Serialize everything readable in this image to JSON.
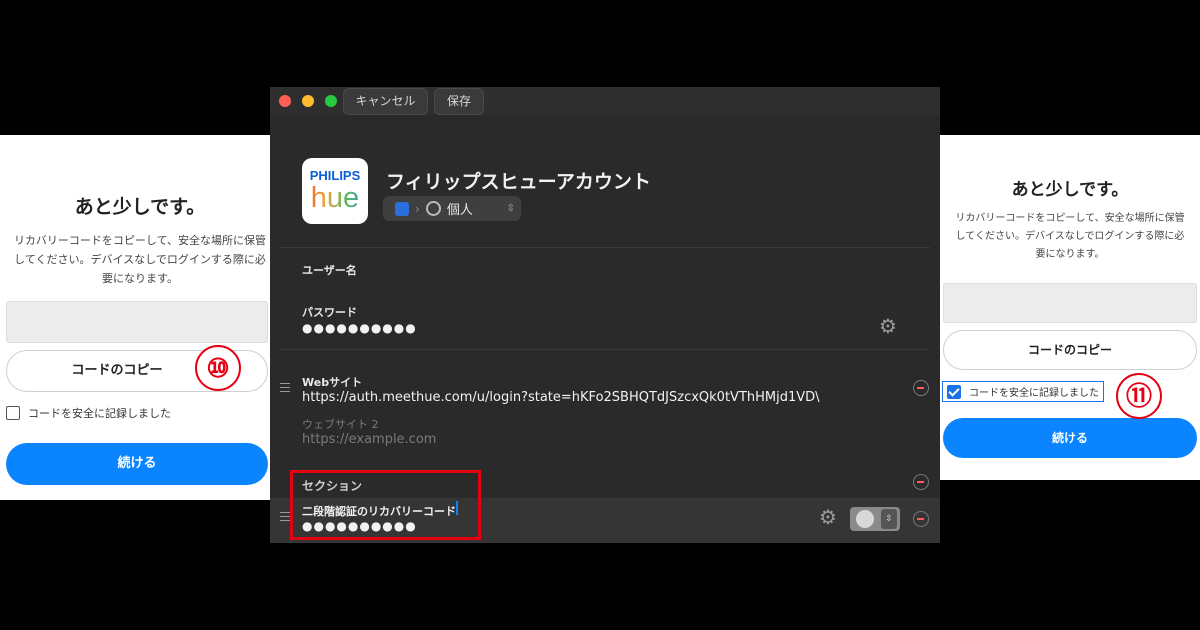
{
  "left_panel": {
    "title": "あと少しです。",
    "desc_lines": [
      "リカバリーコードをコピーして、安全な場所に保管",
      "してください。デバイスなしでログインする際に必",
      "要になります。"
    ],
    "copy_button": "コードのコピー",
    "checkbox_label": "コードを安全に記録しました",
    "checkbox_checked": false,
    "continue_button": "続ける",
    "step_badge": "⑩"
  },
  "right_panel": {
    "title": "あと少しです。",
    "desc_lines": [
      "リカバリーコードをコピーして、安全な場所に保管",
      "してください。デバイスなしでログインする際に必",
      "要になります。"
    ],
    "copy_button": "コードのコピー",
    "checkbox_label": "コードを安全に記録しました",
    "checkbox_checked": true,
    "continue_button": "続ける",
    "step_badge": "⑪"
  },
  "window": {
    "toolbar": {
      "cancel_label": "キャンセル",
      "save_label": "保存"
    },
    "item_title": "フィリップスヒューアカウント",
    "logo": {
      "brand_top": "PHILIPS",
      "brand_bottom": "hue"
    },
    "vault": {
      "name": "個人"
    },
    "fields": {
      "username_label": "ユーザー名",
      "password_label": "パスワード",
      "password_value": "●●●●●●●●●●",
      "website_label": "Webサイト",
      "website_value": "https://auth.meethue.com/u/login?state=hKFo2SBHQTdJSzcxQk0tVThHMjd1VD\\",
      "website2_label": "ウェブサイト 2",
      "website2_placeholder": "https://example.com"
    },
    "section": {
      "label": "セクション",
      "recovery_label": "二段階認証のリカバリーコード",
      "recovery_value": "●●●●●●●●●●"
    }
  },
  "colors": {
    "accent": "#0a84ff",
    "highlight": "#e60012",
    "window_bg": "#2a2a2a"
  }
}
